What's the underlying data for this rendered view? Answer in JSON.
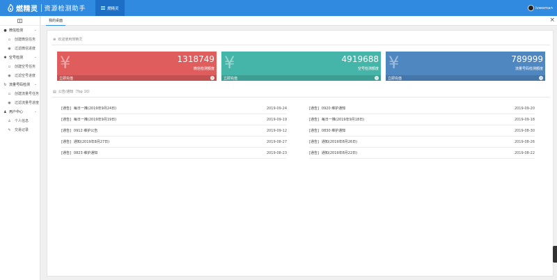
{
  "app": {
    "name": "燃精灵",
    "subtitle": "资源检测助手",
    "top_tab": "燃精灵",
    "user": "lvweman"
  },
  "sidebar": {
    "groups": [
      {
        "label": "微信检测",
        "icon": "chat-icon",
        "items": [
          {
            "label": "创建微信任务",
            "icon": "document-icon"
          },
          {
            "label": "过滤微信进度",
            "icon": "eye-icon"
          }
        ]
      },
      {
        "label": "空号检测",
        "icon": "gear-icon",
        "items": [
          {
            "label": "创建空号任务",
            "icon": "document-icon"
          },
          {
            "label": "过滤空号进度",
            "icon": "eye-icon"
          }
        ]
      },
      {
        "label": "流量号码检测",
        "icon": "refresh-icon",
        "items": [
          {
            "label": "创建流量号任务",
            "icon": "document-icon"
          },
          {
            "label": "过滤流量号进度",
            "icon": "eye-icon"
          }
        ]
      },
      {
        "label": "用户中心",
        "icon": "users-icon",
        "items": [
          {
            "label": "个人信息",
            "icon": "user-icon"
          },
          {
            "label": "交易记录",
            "icon": "edit-icon"
          }
        ]
      }
    ]
  },
  "tabbar": {
    "active_tab": "我的桌面",
    "close_glyph": "×"
  },
  "main": {
    "welcome": "欢迎使用燃精灵",
    "notice_title": "公告/通知（Top 10）",
    "cards": [
      {
        "value": "1318749",
        "caption": "微信检测额度",
        "footer": "立即充值",
        "yen": "¥",
        "color": "#e05d5d"
      },
      {
        "value": "4919688",
        "caption": "空号检测额度",
        "footer": "立即充值",
        "yen": "¥",
        "color": "#46b5a9"
      },
      {
        "value": "789999",
        "caption": "流量号码检测额度",
        "footer": "立即充值",
        "yen": "¥",
        "color": "#4f87c1"
      }
    ],
    "notices_left": [
      {
        "tag": "[通告]",
        "title": "每日一推(2019年9月24日)",
        "date": "2019-09-24"
      },
      {
        "tag": "[通告]",
        "title": "每日一推(2019年9月19日)",
        "date": "2019-09-19"
      },
      {
        "tag": "[通告]",
        "title": "0912 维护公告",
        "date": "2019-09-12"
      },
      {
        "tag": "[通告]",
        "title": "通知(2019年8月27日)",
        "date": "2019-08-27"
      },
      {
        "tag": "[通告]",
        "title": "0823 维护通知",
        "date": "2019-08-23"
      }
    ],
    "notices_right": [
      {
        "tag": "[通告]",
        "title": "0920 维护通知",
        "date": "2019-09-20"
      },
      {
        "tag": "[通告]",
        "title": "每日一推(2019年9月18日)",
        "date": "2019-09-18"
      },
      {
        "tag": "[通告]",
        "title": "0830 维护通知",
        "date": "2019-08-30"
      },
      {
        "tag": "[通告]",
        "title": "通知(2019年8月26日)",
        "date": "2019-08-26"
      },
      {
        "tag": "[通告]",
        "title": "通知(2019年8月22日)",
        "date": "2019-08-22"
      }
    ]
  }
}
